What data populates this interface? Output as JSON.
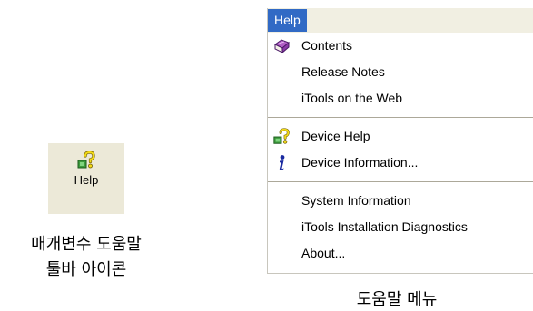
{
  "toolbar_button": {
    "icon": "help-question-icon",
    "label": "Help"
  },
  "left_caption": {
    "line1": "매개변수 도움말",
    "line2": "툴바 아이콘"
  },
  "menu": {
    "title": "Help",
    "groups": [
      [
        {
          "label": "Contents",
          "icon": "book-icon"
        },
        {
          "label": "Release Notes",
          "icon": ""
        },
        {
          "label": "iTools on the Web",
          "icon": ""
        }
      ],
      [
        {
          "label": "Device Help",
          "icon": "help-question-icon"
        },
        {
          "label": "Device Information...",
          "icon": "info-icon"
        }
      ],
      [
        {
          "label": "System Information",
          "icon": ""
        },
        {
          "label": "iTools Installation Diagnostics",
          "icon": ""
        },
        {
          "label": "About...",
          "icon": ""
        }
      ]
    ],
    "highlight_color": "#316ac5"
  },
  "right_caption": "도움말 메뉴"
}
